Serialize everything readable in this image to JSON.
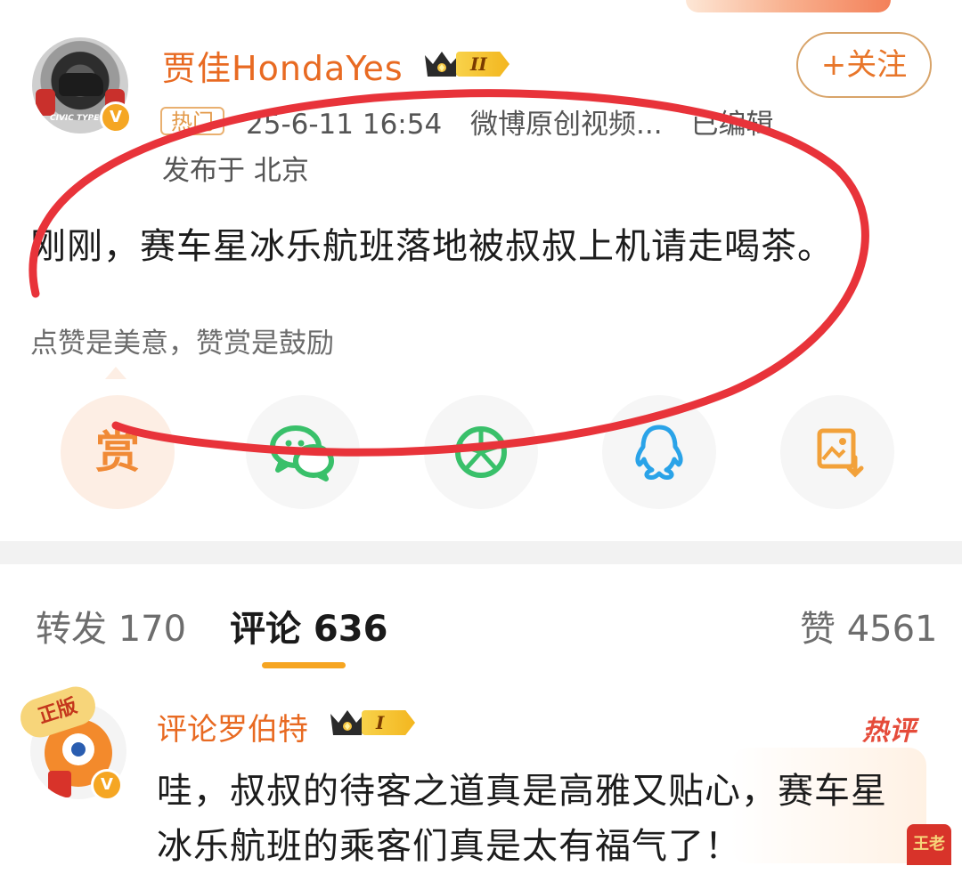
{
  "post": {
    "username": "贾佳HondaYes",
    "level_badge": "II",
    "follow_button": "+关注",
    "hot_tag": "热门",
    "datetime": "25-6-11 16:54",
    "source": "微博原创视频...",
    "edited": "已编辑",
    "location": "发布于 北京",
    "text": "刚刚，赛车星冰乐航班落地被叔叔上机请走喝茶。",
    "reward_tip": "点赞是美意，赞赏是鼓励",
    "avatar_caption": "CIVIC TYPE R",
    "verified_badge": "V"
  },
  "share": {
    "reward_label": "赏",
    "icons": [
      "reward-icon",
      "wechat-icon",
      "moments-icon",
      "qq-icon",
      "save-image-icon"
    ]
  },
  "tabs": {
    "repost": "转发 170",
    "comment": "评论 636",
    "like": "赞 4561"
  },
  "comment": {
    "username": "评论罗伯特",
    "level_badge": "I",
    "hot_label": "热评",
    "avatar_tag": "正版",
    "verified_badge": "V",
    "text": "哇，叔叔的待客之道真是高雅又贴心，赛车星冰乐航班的乘客们真是太有福气了！",
    "corner_can_text": "王老"
  },
  "colors": {
    "username": "#e86a22",
    "accent_orange": "#f6a521",
    "annotation_red": "#e8333a",
    "hot_comment": "#e54b3a"
  }
}
